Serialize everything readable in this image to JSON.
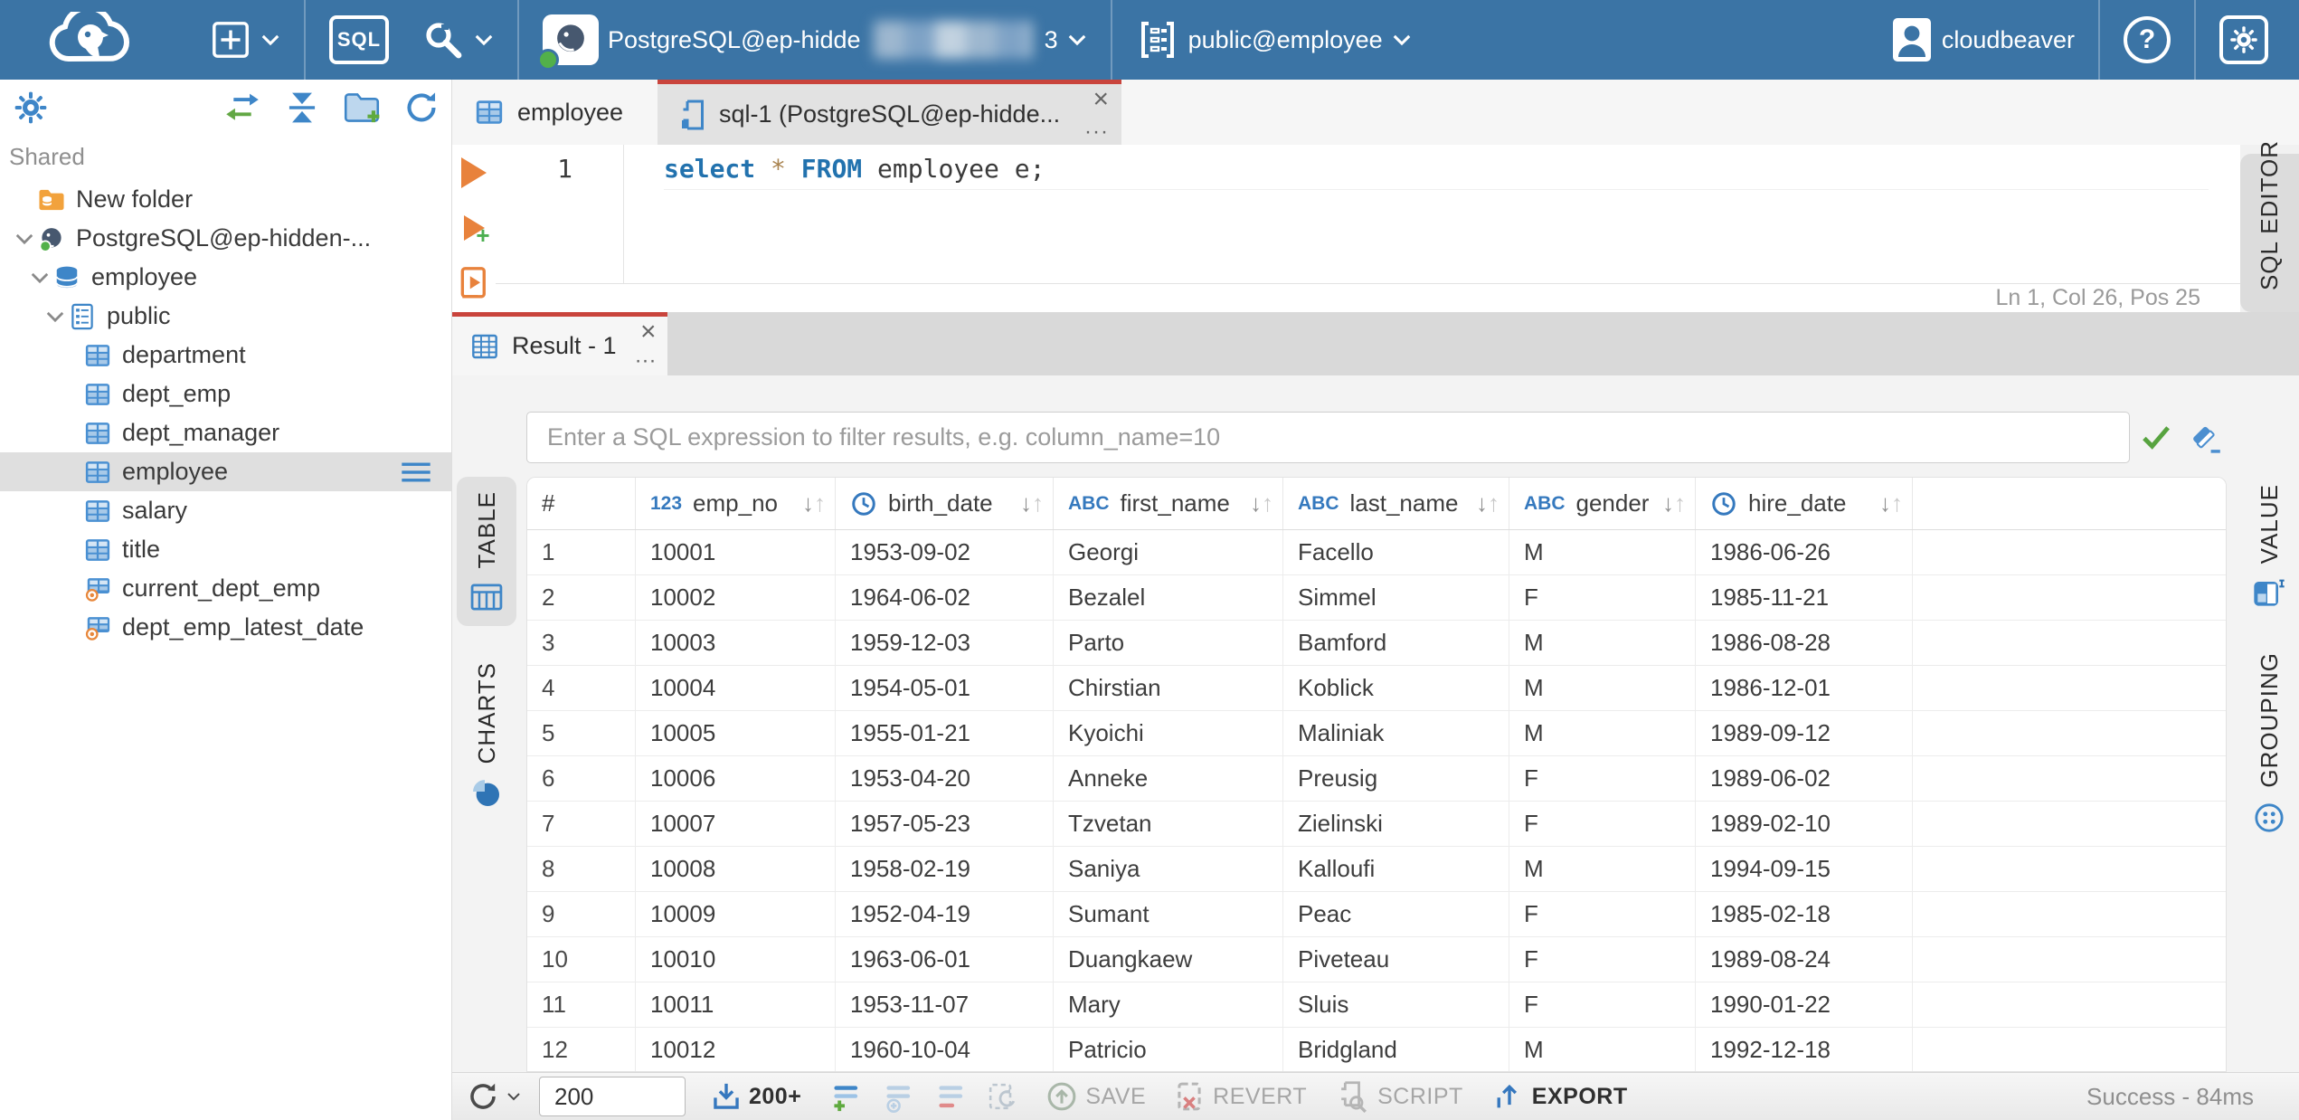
{
  "topbar": {
    "sql_button_label": "SQL",
    "connection_name": "PostgreSQL@ep-hidde",
    "connection_suffix": "3",
    "schema_selector": "public@employee",
    "user_name": "cloudbeaver",
    "help_glyph": "?"
  },
  "sidebar": {
    "section_label": "Shared",
    "tree": [
      {
        "label": "New folder",
        "icon": "folder-db",
        "level": 0,
        "chevron": false,
        "selected": false
      },
      {
        "label": "PostgreSQL@ep-hidden-...",
        "icon": "postgres",
        "level": 0,
        "chevron": true,
        "selected": false
      },
      {
        "label": "employee",
        "icon": "database",
        "level": 1,
        "chevron": true,
        "selected": false
      },
      {
        "label": "public",
        "icon": "schema",
        "level": 2,
        "chevron": true,
        "selected": false
      },
      {
        "label": "department",
        "icon": "table",
        "level": 3,
        "chevron": false,
        "selected": false
      },
      {
        "label": "dept_emp",
        "icon": "table",
        "level": 3,
        "chevron": false,
        "selected": false
      },
      {
        "label": "dept_manager",
        "icon": "table",
        "level": 3,
        "chevron": false,
        "selected": false
      },
      {
        "label": "employee",
        "icon": "table",
        "level": 3,
        "chevron": false,
        "selected": true
      },
      {
        "label": "salary",
        "icon": "table",
        "level": 3,
        "chevron": false,
        "selected": false
      },
      {
        "label": "title",
        "icon": "table",
        "level": 3,
        "chevron": false,
        "selected": false
      },
      {
        "label": "current_dept_emp",
        "icon": "view",
        "level": 3,
        "chevron": false,
        "selected": false
      },
      {
        "label": "dept_emp_latest_date",
        "icon": "view",
        "level": 3,
        "chevron": false,
        "selected": false
      }
    ]
  },
  "editor": {
    "tab_employee": "employee",
    "tab_sql": "sql-1 (PostgreSQL@ep-hidde...",
    "line_number": "1",
    "code": {
      "kw1": "select",
      "star": " * ",
      "kw2": "FROM",
      "rest": " employee e;"
    },
    "status": "Ln 1, Col 26, Pos 25",
    "side_tab": "SQL EDITOR",
    "close_glyph": "×",
    "more_glyph": "···"
  },
  "result": {
    "tab_label": "Result - 1",
    "filter_placeholder": "Enter a SQL expression to filter results, e.g. column_name=10",
    "left_tabs": {
      "table": "TABLE",
      "charts": "CHARTS"
    },
    "right_tabs": {
      "value": "VALUE",
      "grouping": "GROUPING"
    },
    "table": {
      "columns": [
        {
          "label": "#",
          "type": "rownum"
        },
        {
          "label": "emp_no",
          "type": "number",
          "badge": "123"
        },
        {
          "label": "birth_date",
          "type": "date"
        },
        {
          "label": "first_name",
          "type": "text",
          "badge": "ABC"
        },
        {
          "label": "last_name",
          "type": "text",
          "badge": "ABC"
        },
        {
          "label": "gender",
          "type": "text",
          "badge": "ABC"
        },
        {
          "label": "hire_date",
          "type": "date"
        }
      ],
      "rows": [
        [
          "1",
          "10001",
          "1953-09-02",
          "Georgi",
          "Facello",
          "M",
          "1986-06-26"
        ],
        [
          "2",
          "10002",
          "1964-06-02",
          "Bezalel",
          "Simmel",
          "F",
          "1985-11-21"
        ],
        [
          "3",
          "10003",
          "1959-12-03",
          "Parto",
          "Bamford",
          "M",
          "1986-08-28"
        ],
        [
          "4",
          "10004",
          "1954-05-01",
          "Chirstian",
          "Koblick",
          "M",
          "1986-12-01"
        ],
        [
          "5",
          "10005",
          "1955-01-21",
          "Kyoichi",
          "Maliniak",
          "M",
          "1989-09-12"
        ],
        [
          "6",
          "10006",
          "1953-04-20",
          "Anneke",
          "Preusig",
          "F",
          "1989-06-02"
        ],
        [
          "7",
          "10007",
          "1957-05-23",
          "Tzvetan",
          "Zielinski",
          "F",
          "1989-02-10"
        ],
        [
          "8",
          "10008",
          "1958-02-19",
          "Saniya",
          "Kalloufi",
          "M",
          "1994-09-15"
        ],
        [
          "9",
          "10009",
          "1952-04-19",
          "Sumant",
          "Peac",
          "F",
          "1985-02-18"
        ],
        [
          "10",
          "10010",
          "1963-06-01",
          "Duangkaew",
          "Piveteau",
          "F",
          "1989-08-24"
        ],
        [
          "11",
          "10011",
          "1953-11-07",
          "Mary",
          "Sluis",
          "F",
          "1990-01-22"
        ],
        [
          "12",
          "10012",
          "1960-10-04",
          "Patricio",
          "Bridgland",
          "M",
          "1992-12-18"
        ]
      ]
    },
    "toolbar": {
      "row_limit_value": "200",
      "fetch_more": "200+",
      "save": "SAVE",
      "revert": "REVERT",
      "script": "SCRIPT",
      "export": "EXPORT",
      "status": "Success - 84ms"
    }
  },
  "colors": {
    "topbar_blue": "#3B74A5",
    "accent_red": "#C9443C",
    "icon_blue": "#3E86C8",
    "success_green": "#52B04A",
    "exec_orange": "#E8823C"
  }
}
